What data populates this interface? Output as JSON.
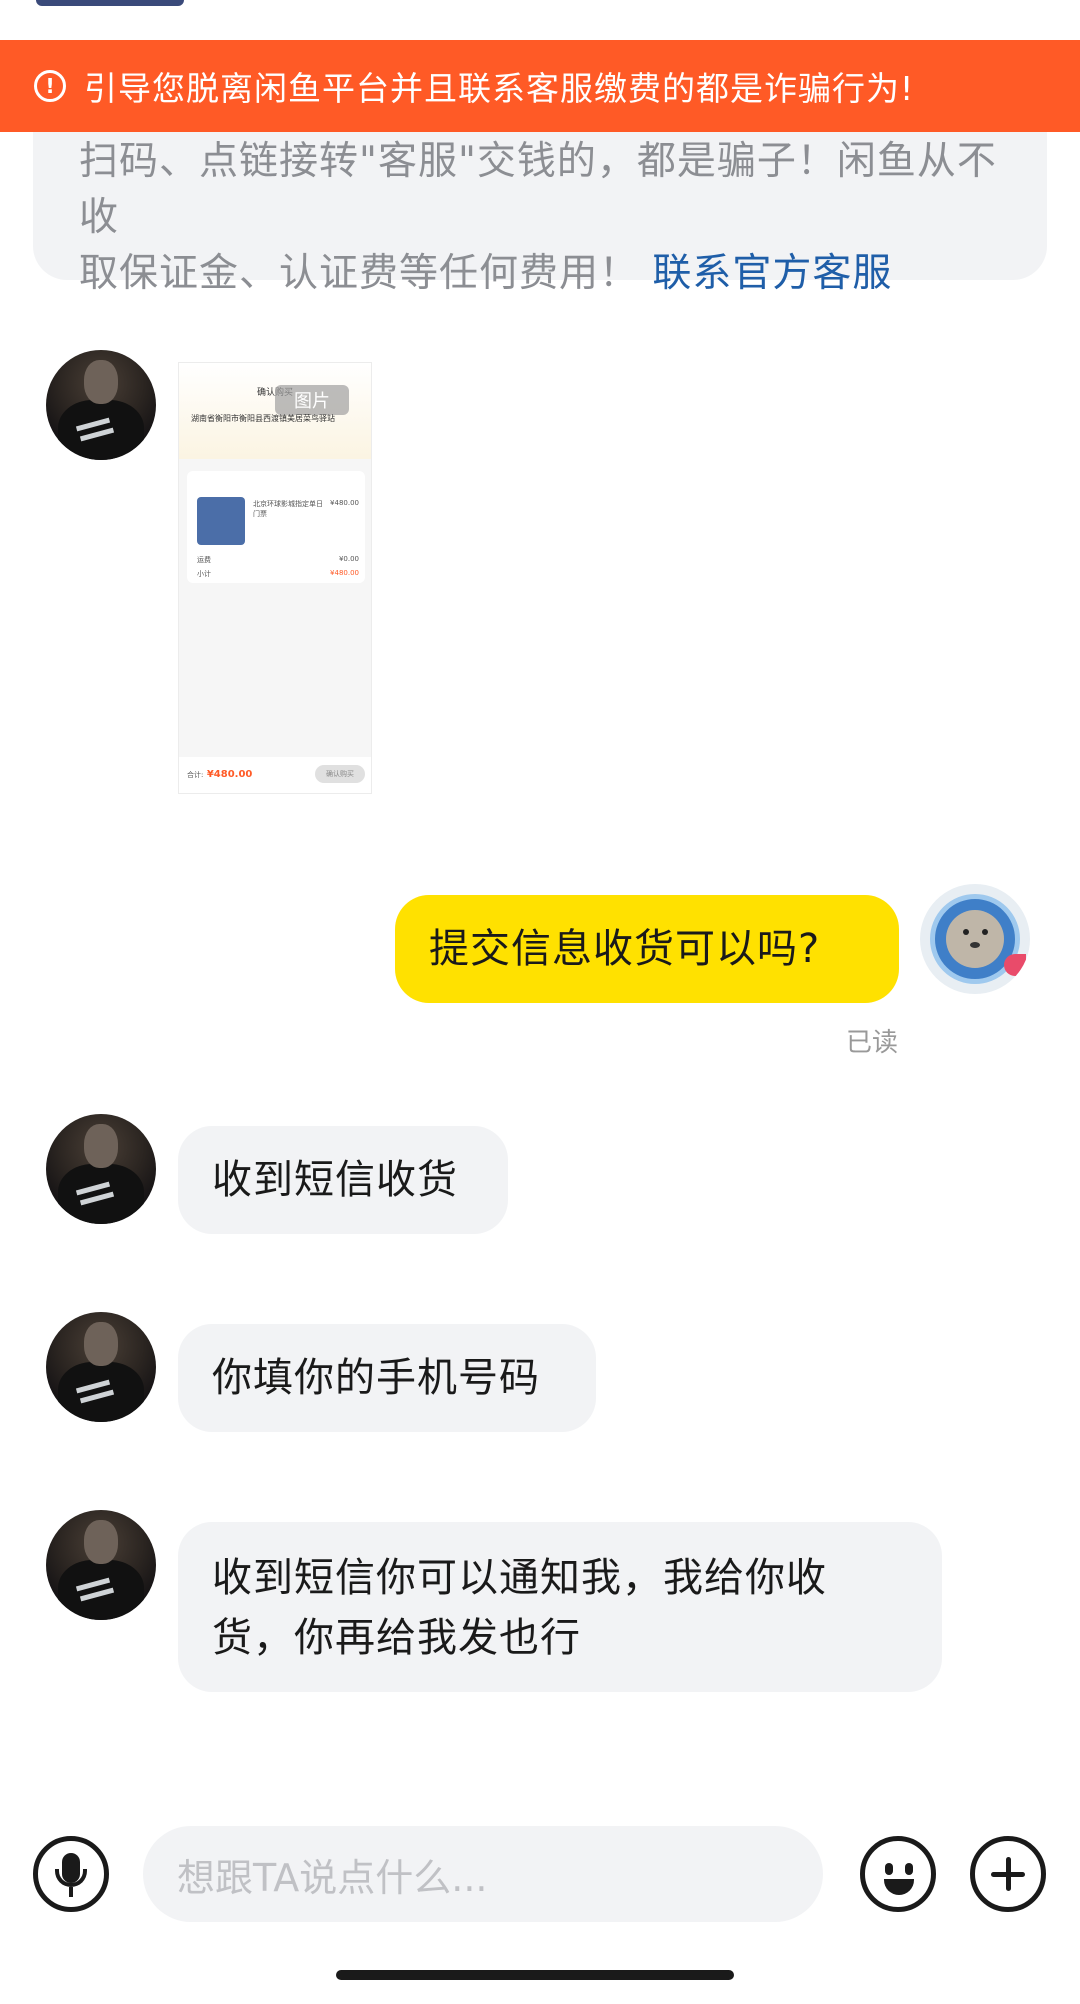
{
  "warning_banner": {
    "icon": "exclamation-circle-icon",
    "text": "引导您脱离闲鱼平台并且联系客服缴费的都是诈骗行为!"
  },
  "notice": {
    "line1": "扫码、点链接转\"客服\"交钱的，都是骗子！闲鱼从不收",
    "line2_prefix": "取保证金、认证费等任何费用！",
    "link": "联系官方客服"
  },
  "messages": [
    {
      "from": "other",
      "type": "image",
      "image": {
        "badge": "图片",
        "title": "确认购买",
        "address": "湖南省衡阳市衡阳县西渡镇美居菜鸟驿站",
        "product": "北京环球影城指定单日门票",
        "price": "¥480.00",
        "shipping_label": "运费",
        "shipping": "¥0.00",
        "subtotal_label": "小计",
        "subtotal": "¥480.00",
        "total_label": "合计:",
        "total": "¥480.00",
        "button": "确认购买"
      }
    },
    {
      "from": "me",
      "type": "text",
      "text": "提交信息收货可以吗?",
      "status": "已读"
    },
    {
      "from": "other",
      "type": "text",
      "text": "收到短信收货"
    },
    {
      "from": "other",
      "type": "text",
      "text": "你填你的手机号码"
    },
    {
      "from": "other",
      "type": "text",
      "lines": [
        "收到短信你可以通知我，我给你收",
        "货，你再给我发也行"
      ]
    }
  ],
  "input_bar": {
    "voice_icon": "microphone-icon",
    "placeholder": "想跟TA说点什么...",
    "emoji_icon": "smile-icon",
    "plus_icon": "plus-icon"
  },
  "colors": {
    "banner": "#ff5a26",
    "my_bubble": "#ffe100",
    "other_bubble": "#f2f3f5",
    "link": "#1f5ea8"
  }
}
